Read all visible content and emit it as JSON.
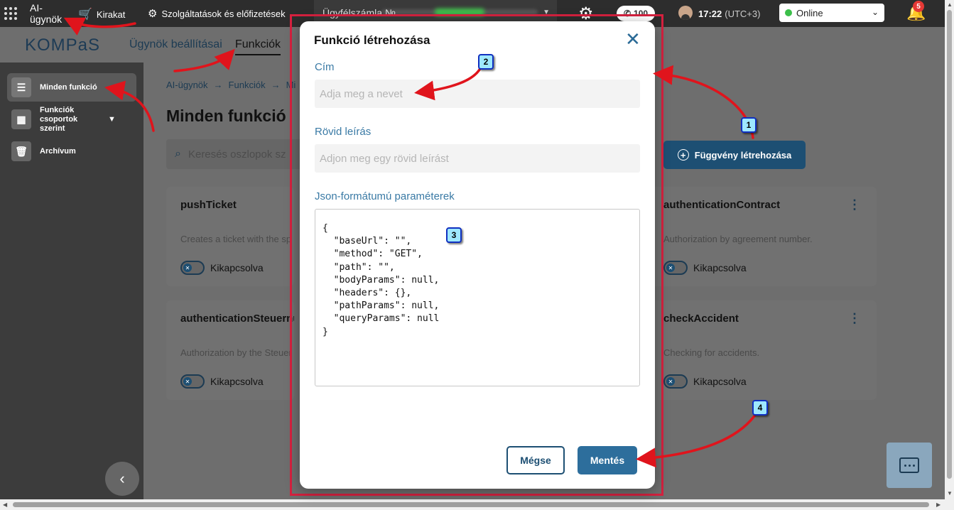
{
  "topbar": {
    "ai_agents": "AI-ügynök",
    "storefront": "Kirakat",
    "services": "Szolgáltatások és előfizetések",
    "customer_account": "Ügyfélszámla №",
    "phone_count": "100",
    "time": "17:22",
    "timezone": "(UTC+3)",
    "status": "Online",
    "notifications": "5"
  },
  "subheader": {
    "logo": "KOMPaS",
    "tabs": [
      {
        "label": "Ügynök beállításai"
      },
      {
        "label": "Funkciók"
      }
    ]
  },
  "sidebar": {
    "items": [
      {
        "label": "Minden funkció",
        "icon": "list-icon"
      },
      {
        "label": "Funkciók csoportok szerint",
        "icon": "grid-icon"
      },
      {
        "label": "Archívum",
        "icon": "archive-icon"
      }
    ]
  },
  "main": {
    "breadcrumb": [
      "AI-ügynök",
      "Funkciók",
      "Mi"
    ],
    "title": "Minden funkció",
    "search_placeholder": "Keresés oszlopok sz",
    "create_button": "Függvény létrehozása",
    "cards": [
      {
        "title": "pushTicket",
        "desc": "Creates a ticket with the sp",
        "status": "Kikapcsolva"
      },
      {
        "title": "authenticationContract",
        "desc": "Authorization by agreement number.",
        "status": "Kikapcsolva"
      },
      {
        "title": "authenticationSteuernu",
        "desc": "Authorization by the Steuer",
        "status": "Kikapcsolva"
      },
      {
        "title": "checkAccident",
        "desc": "Checking for accidents.",
        "status": "Kikapcsolva"
      }
    ]
  },
  "modal": {
    "title": "Funkció létrehozása",
    "name_label": "Cím",
    "name_placeholder": "Adja meg a nevet",
    "short_desc_label": "Rövid leírás",
    "short_desc_placeholder": "Adjon meg egy rövid leírást",
    "json_label": "Json-formátumú paraméterek",
    "json_value": "{\n  \"baseUrl\": \"\",\n  \"method\": \"GET\",\n  \"path\": \"\",\n  \"bodyParams\": null,\n  \"headers\": {},\n  \"pathParams\": null,\n  \"queryParams\": null\n}",
    "cancel": "Mégse",
    "save": "Mentés"
  },
  "annotations": [
    "1",
    "2",
    "3",
    "4"
  ],
  "colors": {
    "accent": "#2d6e9c",
    "highlight": "#d6213f",
    "arrow": "#e0141c"
  }
}
